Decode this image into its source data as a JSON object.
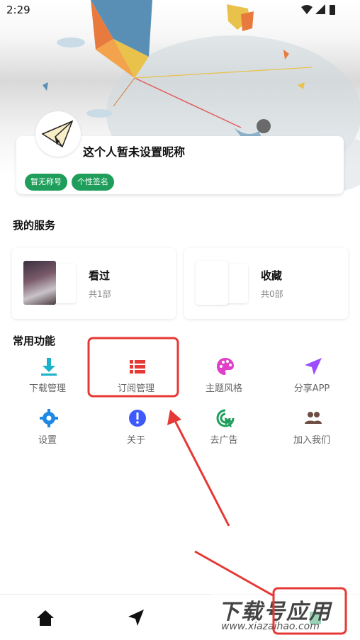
{
  "status_bar": {
    "time": "2:29"
  },
  "profile": {
    "nickname": "这个人暂未设置昵称",
    "tags": [
      "暂无称号",
      "个性签名"
    ]
  },
  "services": {
    "title": "我的服务",
    "cards": [
      {
        "title": "看过",
        "count": "共1部"
      },
      {
        "title": "收藏",
        "count": "共0部"
      }
    ]
  },
  "functions": {
    "title": "常用功能",
    "items": [
      {
        "label": "下载管理",
        "icon": "download-icon",
        "color": "#1ab3c9"
      },
      {
        "label": "订阅管理",
        "icon": "list-icon",
        "color": "#e53935"
      },
      {
        "label": "主题风格",
        "icon": "palette-icon",
        "color": "#e040c8"
      },
      {
        "label": "分享APP",
        "icon": "send-icon",
        "color": "#9c4dff"
      },
      {
        "label": "设置",
        "icon": "gear-icon",
        "color": "#1e88e5"
      },
      {
        "label": "关于",
        "icon": "info-icon",
        "color": "#3d5afe"
      },
      {
        "label": "去广告",
        "icon": "cursor-click-icon",
        "color": "#1f9e5b"
      },
      {
        "label": "加入我们",
        "icon": "group-icon",
        "color": "#6d4c41"
      }
    ]
  },
  "bottom_nav": {
    "items": [
      {
        "icon": "home-icon"
      },
      {
        "icon": "send-icon"
      },
      {
        "icon": "mine-icon"
      }
    ]
  },
  "watermark": {
    "big": "下载号应用",
    "small": "www.xiazaihao.com"
  },
  "colors": {
    "brand_green": "#1f9e5b",
    "annotation_red": "#e53935"
  }
}
